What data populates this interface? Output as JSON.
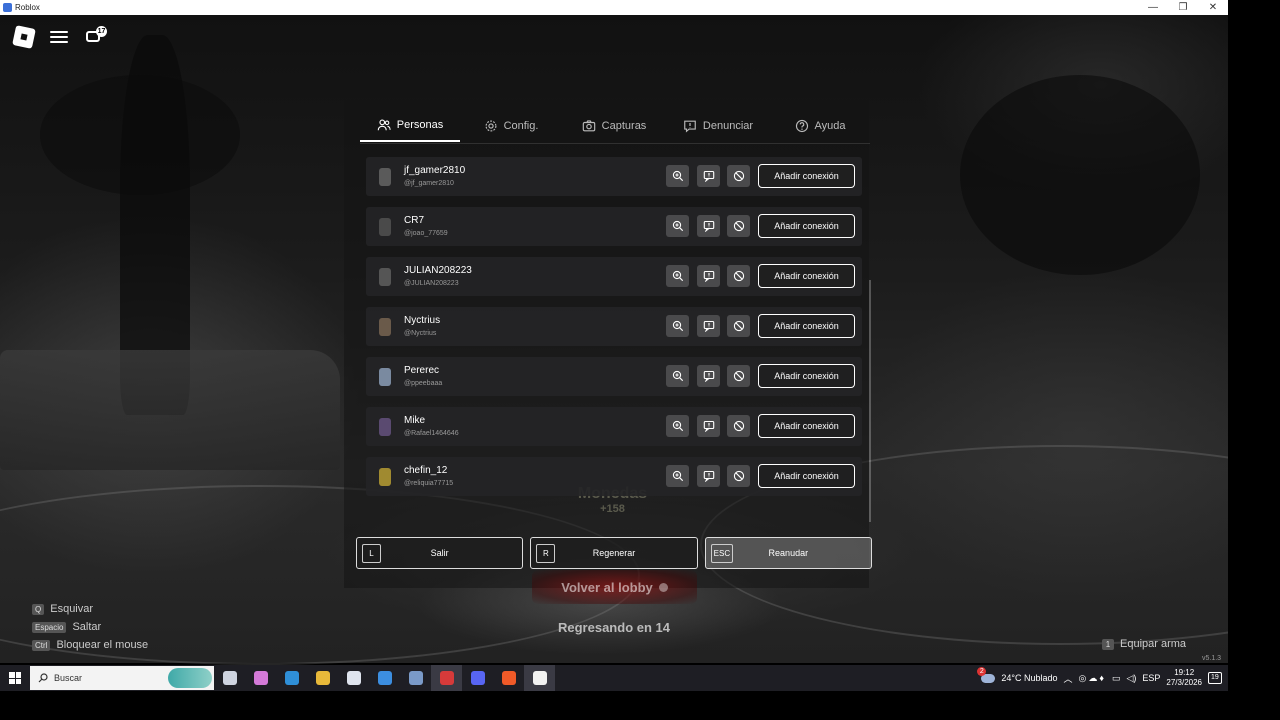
{
  "window": {
    "title": "Roblox",
    "minimize": "—",
    "restore": "❐",
    "close": "✕"
  },
  "hud": {
    "chat_badge": "17"
  },
  "tabs": [
    {
      "label": "Personas",
      "icon": "people-icon",
      "active": true
    },
    {
      "label": "Config.",
      "icon": "gear-icon",
      "active": false
    },
    {
      "label": "Capturas",
      "icon": "camera-icon",
      "active": false
    },
    {
      "label": "Denunciar",
      "icon": "report-icon",
      "active": false
    },
    {
      "label": "Ayuda",
      "icon": "help-icon",
      "active": false
    }
  ],
  "players": [
    {
      "name": "jf_gamer2810",
      "handle": "@jf_gamer2810",
      "add_label": "Añadir conexión",
      "avatar_color": "#5a5a5a"
    },
    {
      "name": "CR7",
      "handle": "@joao_77659",
      "add_label": "Añadir conexión",
      "avatar_color": "#4a4a4a"
    },
    {
      "name": "JULIAN208223",
      "handle": "@JULIAN208223",
      "add_label": "Añadir conexión",
      "avatar_color": "#555555"
    },
    {
      "name": "Nyctrius",
      "handle": "@Nyctrius",
      "add_label": "Añadir conexión",
      "avatar_color": "#6a5a4a"
    },
    {
      "name": "Pererec",
      "handle": "@ppeebaaa",
      "add_label": "Añadir conexión",
      "avatar_color": "#7a8aa0"
    },
    {
      "name": "Mike",
      "handle": "@Rafael1464646",
      "add_label": "Añadir conexión",
      "avatar_color": "#5a4a70"
    },
    {
      "name": "chefin_12",
      "handle": "@reliquia77715",
      "add_label": "Añadir conexión",
      "avatar_color": "#a08a30"
    }
  ],
  "background_text": {
    "coins": "Monedas",
    "coins_value": "+158",
    "lobby": "Volver al lobby",
    "returning": "Regresando en 14"
  },
  "bottom_buttons": [
    {
      "key": "L",
      "label": "Salir",
      "active": false
    },
    {
      "key": "R",
      "label": "Regenerar",
      "active": false
    },
    {
      "key": "ESC",
      "label": "Reanudar",
      "active": true
    }
  ],
  "hints": [
    {
      "key": "Q",
      "label": "Esquivar"
    },
    {
      "key": "Espacio",
      "label": "Saltar"
    },
    {
      "key": "Ctrl",
      "label": "Bloquear el mouse"
    }
  ],
  "equip": {
    "key": "1",
    "label": "Equipar arma"
  },
  "version": "v5.1.3",
  "taskbar": {
    "search_placeholder": "Buscar",
    "apps": [
      {
        "name": "task-view-icon",
        "color": "#cfd4e0"
      },
      {
        "name": "copilot-icon",
        "color": "#d47ad8"
      },
      {
        "name": "edge-icon",
        "color": "#2f8fd8"
      },
      {
        "name": "file-explorer-icon",
        "color": "#e8b93a"
      },
      {
        "name": "store-icon",
        "color": "#dfe4ee"
      },
      {
        "name": "mail-icon",
        "color": "#3c8ee0"
      },
      {
        "name": "steam-icon",
        "color": "#7a9ac8"
      },
      {
        "name": "obs-icon",
        "color": "#d63a3a"
      },
      {
        "name": "discord-icon",
        "color": "#5865f2"
      },
      {
        "name": "brave-icon",
        "color": "#f05a28"
      },
      {
        "name": "roblox-icon",
        "color": "#f2f2f2"
      }
    ],
    "weather": "24°C  Nublado",
    "weather_badge": "2",
    "language": "ESP",
    "time": "19:12",
    "date": "27/3/2026",
    "notifications": "19"
  }
}
